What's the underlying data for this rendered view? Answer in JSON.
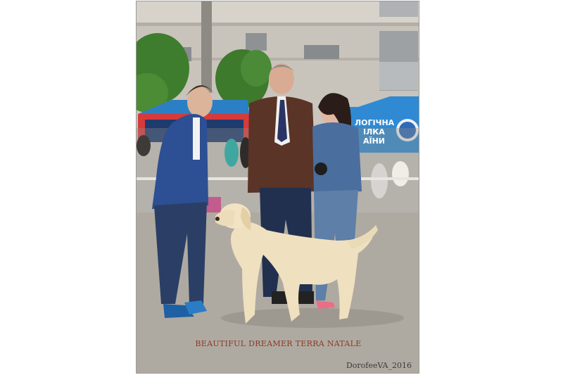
{
  "photo": {
    "subject": "dog-show-photo",
    "caption": "BEAUTIFUL DREAMER TERRA NATALE",
    "watermark": "DorofeeVA_2016",
    "banner_lines": [
      "ЛОГІЧНА",
      "ІЛКА",
      "АЇНИ"
    ],
    "colors": {
      "caption": "#8a3a26",
      "banner": "#2f8ad3",
      "tent_red": "#d8393a",
      "ground": "#a8a39a",
      "dog": "#efe0bf"
    }
  }
}
